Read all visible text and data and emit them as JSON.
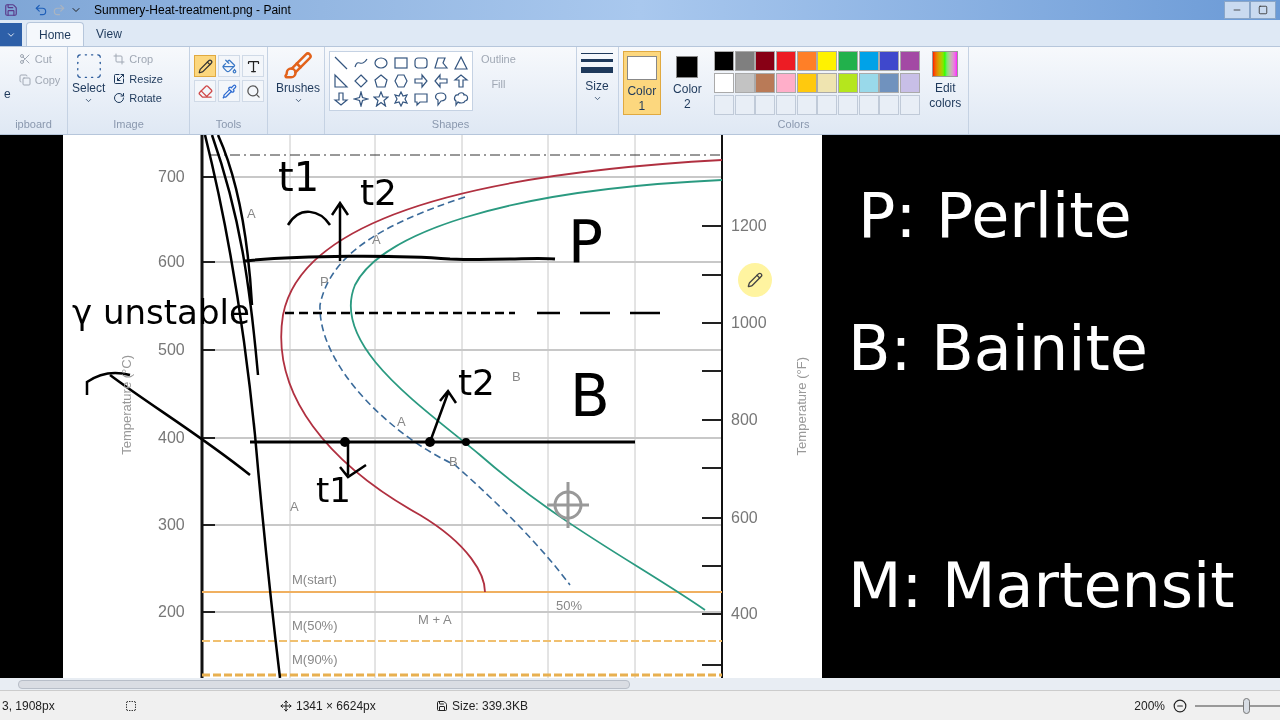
{
  "window": {
    "title": "Summery-Heat-treatment.png - Paint"
  },
  "tabs": [
    {
      "label": "Home",
      "selected": true
    },
    {
      "label": "View",
      "selected": false
    }
  ],
  "ribbon": {
    "clipboard": {
      "label": "ipboard",
      "paste": "e",
      "buttons": [
        {
          "label": "Cut",
          "disabled": true
        },
        {
          "label": "Copy",
          "disabled": true
        }
      ]
    },
    "image": {
      "label": "Image",
      "select": "Select",
      "buttons": [
        {
          "label": "Crop",
          "disabled": true
        },
        {
          "label": "Resize",
          "disabled": false
        },
        {
          "label": "Rotate",
          "disabled": false
        }
      ]
    },
    "tools": {
      "label": "Tools",
      "items": [
        {
          "kind": "pencil",
          "selected": true
        },
        {
          "kind": "fill",
          "selected": false
        },
        {
          "kind": "text",
          "selected": false
        },
        {
          "kind": "eraser",
          "selected": false
        },
        {
          "kind": "picker",
          "selected": false
        },
        {
          "kind": "magnifier",
          "selected": false
        }
      ]
    },
    "brushes": {
      "label": "Brushes"
    },
    "shapes": {
      "label": "Shapes",
      "outline": {
        "label": "Outline",
        "disabled": true
      },
      "fill": {
        "label": "Fill",
        "disabled": true
      }
    },
    "size": {
      "label": "Size"
    },
    "colors": {
      "label": "Colors",
      "edit": "Edit colors",
      "wells": [
        {
          "label": "Color",
          "number": "1",
          "color": "#ffffff",
          "selected": true
        },
        {
          "label": "Color",
          "number": "2",
          "color": "#000000",
          "selected": false
        }
      ],
      "palette": [
        {
          "color": "#000000"
        },
        {
          "color": "#7f7f7f"
        },
        {
          "color": "#880015"
        },
        {
          "color": "#ed1c24"
        },
        {
          "color": "#ff7f27"
        },
        {
          "color": "#fff200"
        },
        {
          "color": "#22b14c"
        },
        {
          "color": "#00a2e8"
        },
        {
          "color": "#3f48cc"
        },
        {
          "color": "#a349a4"
        },
        {
          "color": "#ffffff"
        },
        {
          "color": "#c3c3c3"
        },
        {
          "color": "#b97a57"
        },
        {
          "color": "#ffaec9"
        },
        {
          "color": "#ffc90e"
        },
        {
          "color": "#efe4b0"
        },
        {
          "color": "#b5e61d"
        },
        {
          "color": "#99d9ea"
        },
        {
          "color": "#7092be"
        },
        {
          "color": "#c8bfe7"
        }
      ]
    }
  },
  "canvas": {
    "left_ticks": [
      "700",
      "600",
      "500",
      "400",
      "300",
      "200"
    ],
    "right_ticks": [
      "1200",
      "1000",
      "800",
      "600",
      "400"
    ],
    "left_axis_title": "Temperature (°C)",
    "right_axis_title": "Temperature (°F)",
    "labels": [
      "A",
      "A",
      "P",
      "A",
      "B",
      "A",
      "B",
      "M(start)",
      "M(50%)",
      "M(90%)",
      "M + A",
      "50%"
    ],
    "handwriting": [
      "t1",
      "t2",
      "γ unstable",
      "P",
      "B",
      "t2",
      "t1"
    ],
    "notes": [
      "P: Perlite",
      "B: Bainite",
      "M: Martensit"
    ]
  },
  "status_bar": {
    "position": "3, 1908px",
    "dimensions": "1341 × 6624px",
    "file_size": "Size: 339.3KB",
    "zoom": "200%",
    "zoom_slider": {
      "level": 0.6
    }
  }
}
